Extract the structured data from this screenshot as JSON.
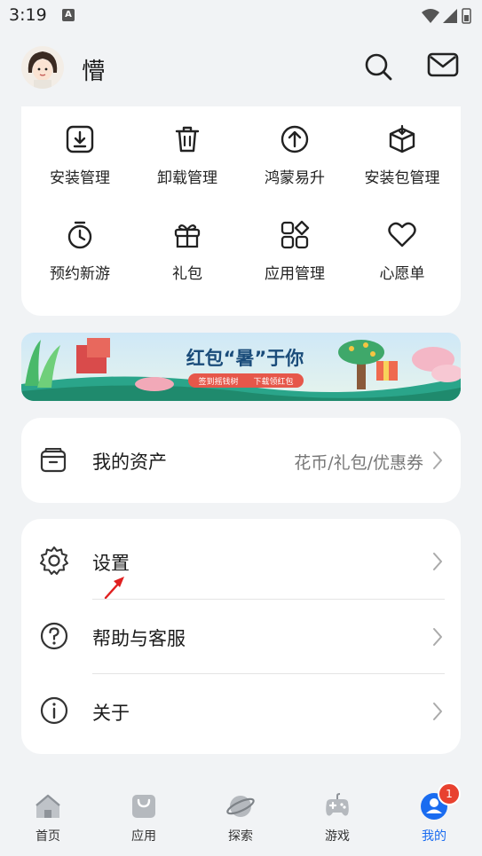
{
  "status_bar": {
    "time": "3:19",
    "notification_letter": "A"
  },
  "header": {
    "username": "懵"
  },
  "quick_actions": [
    {
      "label": "安装管理",
      "icon": "download-box-icon"
    },
    {
      "label": "卸载管理",
      "icon": "trash-icon"
    },
    {
      "label": "鸿蒙易升",
      "icon": "arrow-up-circle-icon"
    },
    {
      "label": "安装包管理",
      "icon": "package-icon"
    },
    {
      "label": "预约新游",
      "icon": "alarm-clock-icon"
    },
    {
      "label": "礼包",
      "icon": "gift-icon"
    },
    {
      "label": "应用管理",
      "icon": "app-grid-icon"
    },
    {
      "label": "心愿单",
      "icon": "heart-icon"
    }
  ],
  "banner": {
    "title": "红包“暑”于你",
    "subtitle_left": "签到摇钱树",
    "subtitle_right": "下载领红包"
  },
  "assets": {
    "label": "我的资产",
    "value": "花币/礼包/优惠券"
  },
  "settings": [
    {
      "label": "设置",
      "icon": "gear-icon"
    },
    {
      "label": "帮助与客服",
      "icon": "question-circle-icon"
    },
    {
      "label": "关于",
      "icon": "info-circle-icon"
    }
  ],
  "tabbar": {
    "tabs": [
      {
        "label": "首页",
        "icon": "home-icon"
      },
      {
        "label": "应用",
        "icon": "bag-icon"
      },
      {
        "label": "探索",
        "icon": "planet-icon"
      },
      {
        "label": "游戏",
        "icon": "gamepad-icon"
      },
      {
        "label": "我的",
        "icon": "user-icon"
      }
    ],
    "active_index": 4,
    "badge_count": "1"
  },
  "colors": {
    "accent": "#1a6cf0",
    "badge": "#e8412f",
    "annotation_arrow": "#e02020"
  }
}
